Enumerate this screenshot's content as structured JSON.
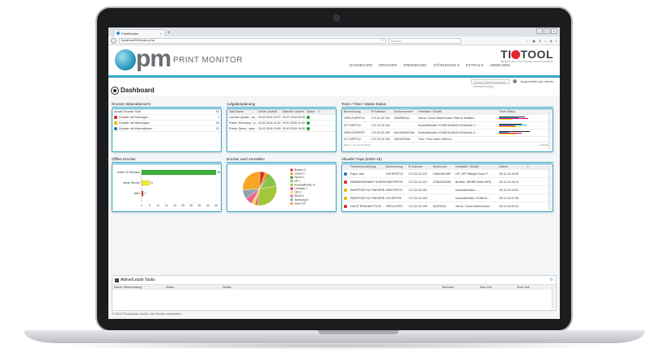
{
  "browser": {
    "tab_title": "PrintMonitor",
    "url": "localhost/0/0/index.php",
    "search_placeholder": "Suchen",
    "reload_glyph": "C",
    "window_controls": [
      "–",
      "□",
      "×"
    ]
  },
  "header": {
    "logo_pm": "pm",
    "logo_tag": "PRINT MONITOR",
    "nav": [
      "DASHBOARD",
      "DRUCKER",
      "ERKENNUNG",
      "STÖRUNGEN ▾",
      "EXTRAS ▾",
      "ABMELDEN"
    ],
    "brand_name_pre": "TI",
    "brand_name_post": "TOOL",
    "brand_sub": "BERATUNG SOFTWARE MANAGEMENT",
    "search_box": "Suche (Seriennummer, Bezeichnung)",
    "user": "Angemeldet als: admin"
  },
  "dashboard": {
    "title": "Dashboard"
  },
  "status_panel": {
    "title": "Drucker Statusübersicht",
    "rows": [
      {
        "label": "Anzahl Drucker Total",
        "count": "51",
        "icon": "none"
      },
      {
        "label": "Drucker mit Störungen",
        "count": "1",
        "icon": "error"
      },
      {
        "label": "Drucker mit Warnungen",
        "count": "29",
        "icon": "warning"
      },
      {
        "label": "Drucker mit Informationen",
        "count": "21",
        "icon": "info"
      }
    ]
  },
  "tasks_panel": {
    "title": "Aufgabenplanung",
    "headers": [
      "Task Name",
      "Letzte Laufzeit",
      "Nächste Laufzeit",
      "Status"
    ],
    "rows": [
      [
        "License Update - au...",
        "15.03.2016 10:37",
        "15.07.2016 00:00",
        "ok"
      ],
      [
        "Printer Discovery - a...",
        "15.03.2016 11:00",
        "15.07.2016 11:00",
        "ok"
      ],
      [
        "Printer Query - auto...",
        "15.03.2016 15:59",
        "15.03.2016 16:00",
        "ok"
      ]
    ]
  },
  "toner_panel": {
    "title": "Toner / Tinte / Waste Status",
    "headers": [
      "Bezeichnung",
      "IP Adresse",
      "Seriennummer",
      "Hersteller / Modell",
      "Toner Status"
    ],
    "rows": [
      [
        "GERLOVPRT11",
        "172.22.42.124",
        "30GFB0311",
        "Xerox / Xerox WorkCentre 7556 v1 Multifun..."
      ],
      [
        "ATT-SPRT10",
        "172.22.10.124",
        "",
        "KonicaMinolta / KONICA MINOLTA bizhub C..."
      ],
      [
        "GERLOVPRT07",
        "172.22.42.109",
        "A5C06000213A",
        "KonicaMinolta / KONICA MINOLTA bizhub C..."
      ],
      [
        "ATT-SPRT12",
        "172.22.10.133",
        "3301MTE6A",
        "Toru / Toru Laser 2431sm..."
      ]
    ],
    "footer": "Zeile 1 - 11 von 51 Zeilen",
    "entries": "11 Einträge"
  },
  "offline_panel": {
    "title": "Offline Drucker"
  },
  "vendor_panel": {
    "title": "Drucker nach Hersteller"
  },
  "traps_panel": {
    "title": "Aktuelle Traps (letzte 15)",
    "headers": [
      "Fehlerbeschreibung",
      "Bezeichnung",
      "IP Adresse",
      "Seriennum.",
      "Hersteller / Modell",
      "Datum"
    ],
    "rows": [
      {
        "icon": "info",
        "cells": [
          "Paper Jam",
          "CHCEPRT13",
          "172.22.22.122",
          "CNATB013SF",
          "HP / HP Officejet Color P...",
          "25.10.16 15:39"
        ]
      },
      {
        "icon": "error",
        "cells": [
          "NUMBERSIGNBIT SUPER...",
          "DEBTPRT09",
          "172.22.92.119",
          "17962023338",
          "Brother / BRIER letzte MFB...",
          "25.10.16 15:19"
        ]
      },
      {
        "icon": "warning",
        "cells": [
          "WARTEZEIT01 FINISHER...",
          "DEBTPRT07",
          "172.22.92.102",
          "",
          "KonicaMinolta / ...",
          "25.10.16 14:03"
        ]
      },
      {
        "icon": "warning",
        "cells": [
          "WARTEZEIT01 FINISHER...",
          "CHCEPRT6",
          "172.22.22.104",
          "",
          "KonicaMinolta / KONICA ...",
          "25.10.16 07:55"
        ]
      },
      {
        "icon": "error",
        "cells": [
          "NICHT ERKANNT FIVE...",
          "GERLOVPR...",
          "172.22.42.109",
          "30GF0011",
          "Xerox / Xerox WorkCentre...",
          "25.10.16 09:34"
        ]
      }
    ]
  },
  "active_tasks": {
    "title": "Aktive/Letzte Tasks",
    "headers": [
      "Name / Beschreibung",
      "Status",
      "Details",
      "Benutzer",
      "Start Zeit",
      "Ende Zeit"
    ]
  },
  "footer": {
    "text": "© 2016 TIToolAusbeu GmbH, Alle Rechte vorbehalten."
  },
  "chart_data": [
    {
      "type": "bar",
      "orientation": "horizontal",
      "categories": [
        "letzte 24 Stunden",
        "letzte Woche",
        "Älter"
      ],
      "values": [
        45,
        5,
        1
      ],
      "xlim": [
        0,
        45
      ],
      "xticks": [
        "0",
        "5",
        "10",
        "15",
        "20",
        "25",
        "30",
        "35",
        "40",
        "45"
      ],
      "colors": [
        "#3bae3b",
        "#f3e83b",
        "#d9342b"
      ]
    },
    {
      "type": "pie",
      "labels": [
        "Brother 3",
        "Canon 2",
        "Epson 1",
        "HP 7",
        "KonicaMinolta 17",
        "Lexmark 1",
        "OKI 2",
        "Ricoh 4",
        "Samsung 5",
        "Xerox 15"
      ],
      "values": [
        3,
        2,
        1,
        7,
        17,
        1,
        2,
        4,
        5,
        15
      ],
      "colors": [
        "#d9342b",
        "#f39c12",
        "#3b8e3b",
        "#8bc34a",
        "#a4c639",
        "#e91e63",
        "#ffd54f",
        "#f06292",
        "#90a4ae",
        "#f5a623"
      ]
    }
  ]
}
